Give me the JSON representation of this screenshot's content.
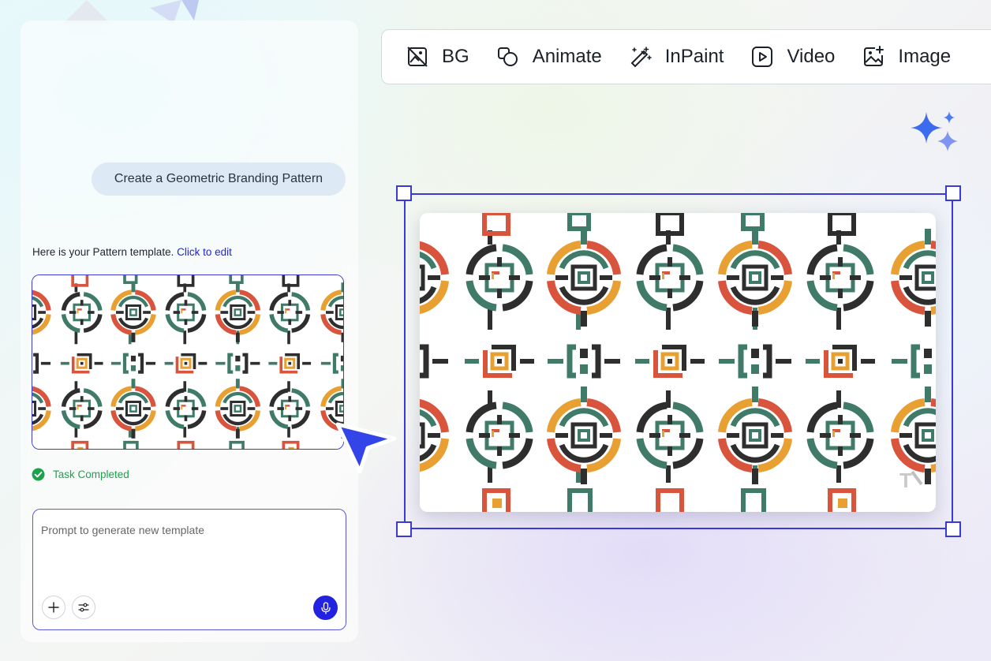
{
  "toolbar": {
    "tools": [
      {
        "label": "BG",
        "icon": "bg-remove-icon"
      },
      {
        "label": "Animate",
        "icon": "animate-icon"
      },
      {
        "label": "InPaint",
        "icon": "magic-wand-icon"
      },
      {
        "label": "Video",
        "icon": "video-play-icon"
      },
      {
        "label": "Image",
        "icon": "image-add-icon"
      }
    ]
  },
  "chat": {
    "user_message": "Create a Geometric Branding Pattern",
    "reply_text": "Here is your Pattern template. ",
    "reply_link": "Click to edit",
    "status": "Task Completed",
    "prompt": {
      "placeholder": "Prompt to generate new template",
      "value": ""
    }
  },
  "pattern": {
    "colors": {
      "dark": "#2e2e2e",
      "green": "#3f7b68",
      "red": "#d9543d",
      "orange": "#e8a033"
    }
  },
  "theme": {
    "accent": "#2222e0",
    "selection": "#3a3ad6",
    "success": "#1aa34a"
  }
}
